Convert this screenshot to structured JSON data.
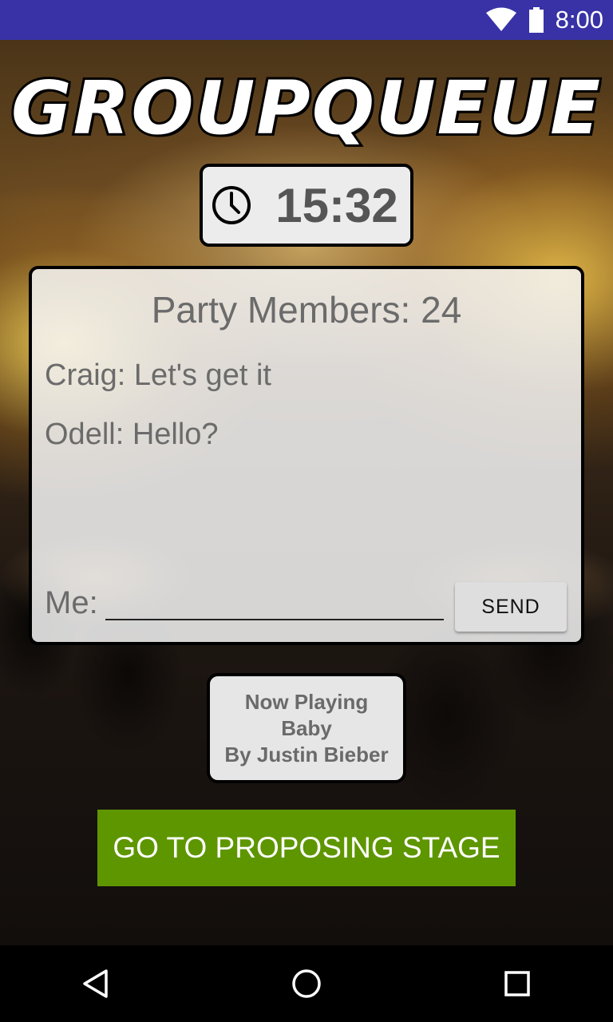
{
  "status_bar": {
    "time": "8:00",
    "icons": [
      "wifi-icon",
      "battery-icon"
    ]
  },
  "app": {
    "logo_text": "GROUPQUEUE"
  },
  "timer": {
    "icon": "clock-icon",
    "value": "15:32"
  },
  "chat": {
    "members_label": "Party Members: 24",
    "messages": [
      {
        "text": "Craig: Let's get it"
      },
      {
        "text": "Odell: Hello?"
      }
    ],
    "me_label": "Me:",
    "input_value": "",
    "input_placeholder": "",
    "send_label": "SEND"
  },
  "now_playing": {
    "heading": "Now Playing",
    "song": "Baby",
    "artist": "By Justin Bieber"
  },
  "actions": {
    "proposing_label": "GO TO PROPOSING STAGE",
    "proposing_color": "#5e9600"
  },
  "nav": {
    "icons": [
      "back-icon",
      "home-icon",
      "recents-icon"
    ]
  },
  "colors": {
    "status_bar": "#3832a6"
  }
}
